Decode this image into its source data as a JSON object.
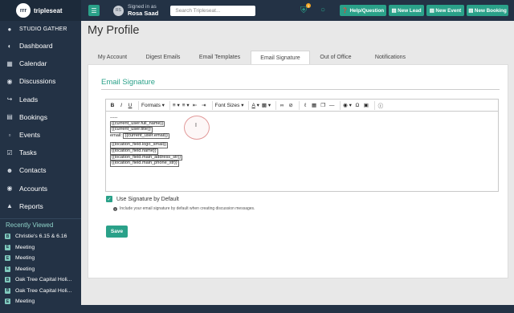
{
  "brand": {
    "logo_text": "rrr",
    "name": "tripleseat"
  },
  "sidebar": {
    "venue": "STUDIO GATHER",
    "items": [
      {
        "label": "Dashboard",
        "icon": "dashboard-icon"
      },
      {
        "label": "Calendar",
        "icon": "calendar-icon"
      },
      {
        "label": "Discussions",
        "icon": "chat-icon"
      },
      {
        "label": "Leads",
        "icon": "leads-icon"
      },
      {
        "label": "Bookings",
        "icon": "bookings-icon"
      },
      {
        "label": "Events",
        "icon": "events-icon"
      },
      {
        "label": "Tasks",
        "icon": "tasks-icon"
      },
      {
        "label": "Contacts",
        "icon": "contacts-icon"
      },
      {
        "label": "Accounts",
        "icon": "accounts-icon"
      },
      {
        "label": "Reports",
        "icon": "reports-icon"
      }
    ],
    "recent_title": "Recently Viewed",
    "recent": [
      {
        "badge": "B",
        "label": "Christie's 6.15 & 6.16"
      },
      {
        "badge": "E",
        "label": "Meeting"
      },
      {
        "badge": "E",
        "label": "Meeting"
      },
      {
        "badge": "E",
        "label": "Meeting"
      },
      {
        "badge": "B",
        "label": "Oak Tree Capital Holi..."
      },
      {
        "badge": "B",
        "label": "Oak Tree Capital Holi..."
      },
      {
        "badge": "E",
        "label": "Meeting"
      }
    ]
  },
  "topbar": {
    "avatar_initials": "RS",
    "signed_in_as": "Signed in as",
    "user_name": "Rosa Saad",
    "search_placeholder": "Search Tripleseat...",
    "notification_count": "1",
    "buttons": {
      "help": "Help/Question",
      "new_lead": "New Lead",
      "new_event": "New Event",
      "new_booking": "New Booking"
    }
  },
  "page": {
    "title": "My Profile"
  },
  "tabs": [
    {
      "label": "My Account"
    },
    {
      "label": "Digest Emails"
    },
    {
      "label": "Email Templates"
    },
    {
      "label": "Email Signature",
      "active": true
    },
    {
      "label": "Out of Office"
    },
    {
      "label": "Notifications"
    }
  ],
  "panel": {
    "title": "Email Signature",
    "toolbar": {
      "bold": "B",
      "italic": "I",
      "underline": "U",
      "formats": "Formats",
      "font_sizes": "Font Sizes"
    },
    "content_lines": {
      "l0": "-----",
      "l1": "{{current_user.full_name}}",
      "l2": "{{current_user.title}}",
      "l3_prefix": "email: ",
      "l3_tag": "{{current_user.email}}",
      "l4": "{{location_field.logo_small}}",
      "l5": "{{location_field.name}}",
      "l6": "{{location_field.main_address_str}}",
      "l7": "{{location_field.main_phone_str}}"
    },
    "checkbox_label": "Use Signature by Default",
    "checkbox_checked": true,
    "help_text": "Include your email signature by default when creating discussion messages.",
    "save_label": "Save"
  },
  "colors": {
    "accent": "#2aa189",
    "sidebar": "#233245"
  }
}
